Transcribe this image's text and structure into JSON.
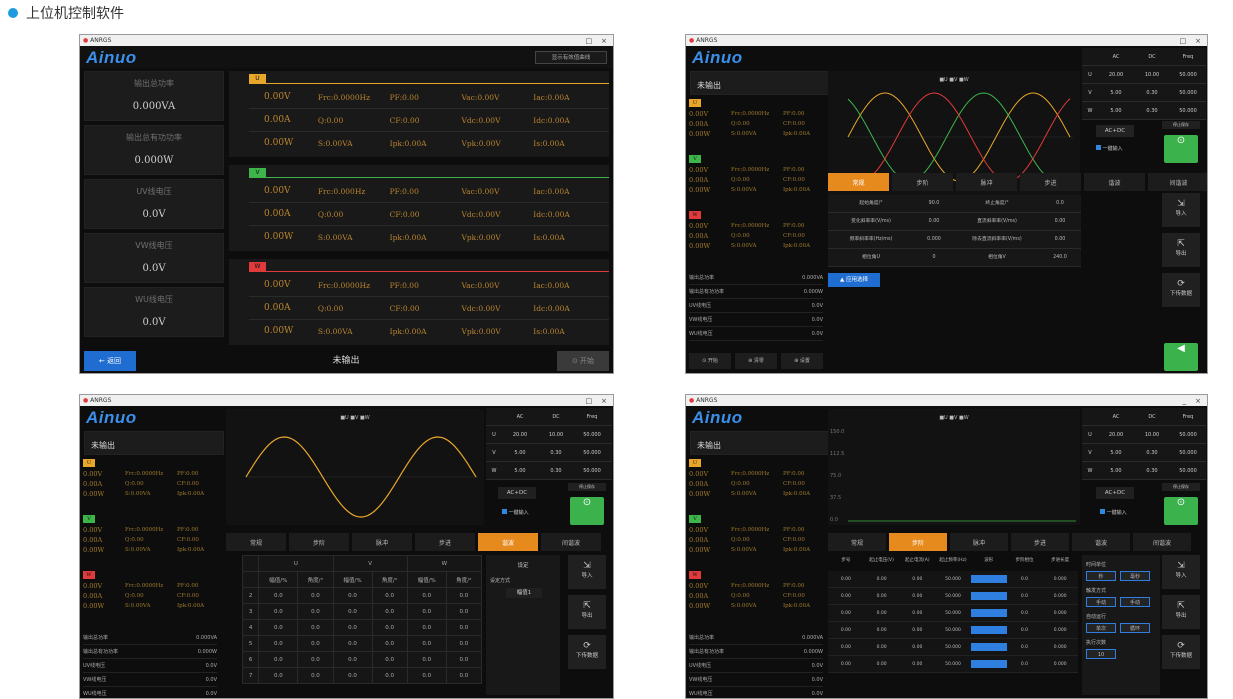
{
  "heading": {
    "title": "上位机控制软件",
    "color": "#1e9be0"
  },
  "window": {
    "title": "ANRGS",
    "logo": "Ainuo",
    "min": "_",
    "max": "□",
    "close": "×"
  },
  "s1": {
    "show_curve": "显示有效值曲线",
    "left": [
      {
        "title": "输出总功率",
        "value": "0.000VA"
      },
      {
        "title": "输出总有功功率",
        "value": "0.000W"
      },
      {
        "title": "UV线电压",
        "value": "0.0V"
      },
      {
        "title": "VW线电压",
        "value": "0.0V"
      },
      {
        "title": "WU线电压",
        "value": "0.0V"
      }
    ],
    "groups": [
      {
        "tag": "U",
        "color": "#e8a72a",
        "rows": [
          [
            "0.00V",
            "Frc:0.0000Hz",
            "PF:0.00",
            "Vac:0.00V",
            "Iac:0.00A"
          ],
          [
            "0.00A",
            "Q:0.00",
            "CF:0.00",
            "Vdc:0.00V",
            "Idc:0.00A"
          ],
          [
            "0.00W",
            "S:0.00VA",
            "Ipk:0.00A",
            "Vpk:0.00V",
            "Is:0.00A"
          ]
        ]
      },
      {
        "tag": "V",
        "color": "#3db54a",
        "rows": [
          [
            "0.00V",
            "Frc:0.000Hz",
            "PF:0.00",
            "Vac:0.00V",
            "Iac:0.00A"
          ],
          [
            "0.00A",
            "Q:0.00",
            "CF:0.00",
            "Vdc:0.00V",
            "Idc:0.00A"
          ],
          [
            "0.00W",
            "S:0.00VA",
            "Ipk:0.00A",
            "Vpk:0.00V",
            "Is:0.00A"
          ]
        ]
      },
      {
        "tag": "W",
        "color": "#e03a3a",
        "rows": [
          [
            "0.00V",
            "Frc:0.0000Hz",
            "PF:0.00",
            "Vac:0.00V",
            "Iac:0.00A"
          ],
          [
            "0.00A",
            "Q:0.00",
            "CF:0.00",
            "Vdc:0.00V",
            "Idc:0.00A"
          ],
          [
            "0.00W",
            "S:0.00VA",
            "Ipk:0.00A",
            "Vpk:0.00V",
            "Is:0.00A"
          ]
        ]
      }
    ],
    "back": "← 返回",
    "status": "未输出",
    "start": "⊙ 开始"
  },
  "common": {
    "status": "未输出",
    "legend": "■U ■V ■W",
    "ac_dc": "AC+DC",
    "check": "一键输入",
    "tabs": [
      "常规",
      "步阶",
      "脉冲",
      "步进",
      "谐波",
      "间谐波"
    ],
    "side": [
      "导入",
      "导出",
      "下传数据",
      "运行"
    ],
    "stop_save": "停止保存",
    "meters_head": [
      "",
      "AC",
      "DC",
      "Freq"
    ],
    "meters": [
      [
        "U",
        "20.00",
        "10.00",
        "50.000"
      ],
      [
        "V",
        "5.00",
        "0.30",
        "50.000"
      ],
      [
        "W",
        "5.00",
        "0.30",
        "50.000"
      ]
    ],
    "mini": [
      {
        "c": "#e8a72a",
        "t": "U",
        "r": [
          [
            "0.00V",
            "Frc:0.0000Hz",
            "PF:0.00"
          ],
          [
            "0.00A",
            "Q:0.00",
            "CF:0.00"
          ],
          [
            "0.00W",
            "S:0.00VA",
            "Ipk:0.00A"
          ]
        ]
      },
      {
        "c": "#3db54a",
        "t": "V",
        "r": [
          [
            "0.00V",
            "Frc:0.0000Hz",
            "PF:0.00"
          ],
          [
            "0.00A",
            "Q:0.00",
            "CF:0.00"
          ],
          [
            "0.00W",
            "S:0.00VA",
            "Ipk:0.00A"
          ]
        ]
      },
      {
        "c": "#e03a3a",
        "t": "W",
        "r": [
          [
            "0.00V",
            "Frc:0.0000Hz",
            "PF:0.00"
          ],
          [
            "0.00A",
            "Q:0.00",
            "CF:0.00"
          ],
          [
            "0.00W",
            "S:0.00VA",
            "Ipk:0.00A"
          ]
        ]
      }
    ],
    "totals": [
      [
        "输出总功率",
        "0.000VA"
      ],
      [
        "输出总有功功率",
        "0.000W"
      ],
      [
        "UV线电压",
        "0.0V"
      ],
      [
        "VW线电压",
        "0.0V"
      ],
      [
        "WU线电压",
        "0.0V"
      ]
    ],
    "bottom": [
      "⊙ 开始",
      "⊕ 清零",
      "⊕ 设置"
    ]
  },
  "s2": {
    "params": [
      [
        "起始角度/°",
        "90.0",
        "终止角度/°",
        "0.0"
      ],
      [
        "变化斜率率(V/ms)",
        "0.00",
        "直流斜率率(V/ms)",
        "0.00"
      ],
      [
        "频率斜率率(Hz/ms)",
        "0.000",
        "除去直流斜率率(V/ms)",
        "0.00"
      ],
      [
        "相位角U",
        "0",
        "相位角V",
        "240.0"
      ]
    ],
    "apply": "▲ 应用选择"
  },
  "s3": {
    "mode_label": "设定方式",
    "mode_val": "幅值1",
    "set": "设定",
    "head": [
      "U",
      "V",
      "W"
    ],
    "sub": [
      "幅值/%",
      "角度/°",
      "幅值/%",
      "角度/°",
      "幅值/%",
      "角度/°"
    ],
    "rows": [
      "2",
      "3",
      "4",
      "5",
      "6",
      "7"
    ]
  },
  "s4": {
    "right": {
      "l1": "时间单位",
      "a": "秒",
      "b": "毫秒",
      "l2": "触发方式",
      "c": "手动",
      "d": "手动",
      "l3": "自动运行",
      "e": "单次",
      "f": "循环",
      "l4": "执行次数",
      "g": "10"
    },
    "cols": [
      "步号",
      "起止电压(V)",
      "起止电流(A)",
      "起止频率(Hz)",
      "波形",
      "步阶相位",
      "步进长度"
    ],
    "y": [
      "150.0",
      "112.5",
      "75.0",
      "37.5",
      "0.0"
    ]
  }
}
